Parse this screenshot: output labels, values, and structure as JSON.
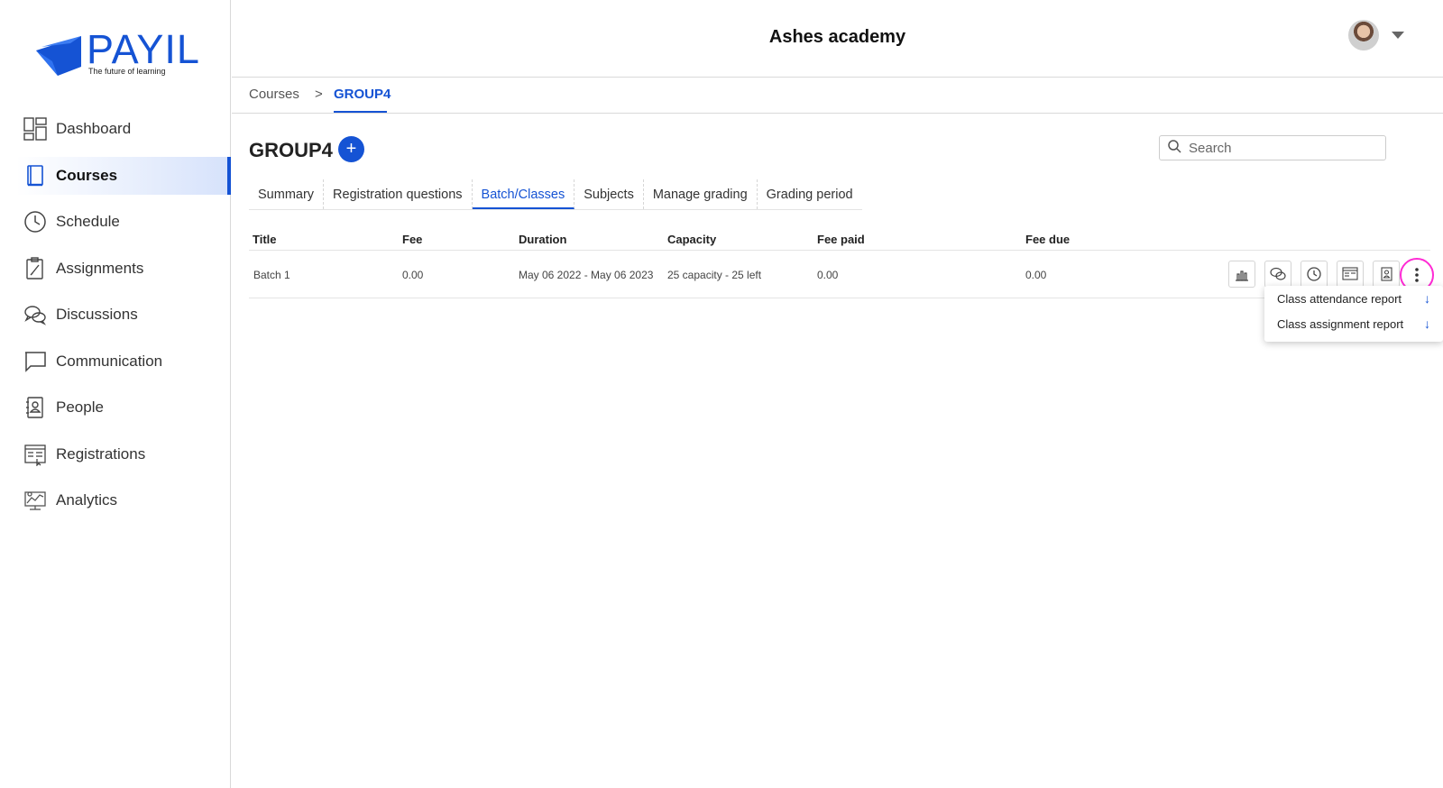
{
  "app": {
    "logo_text": "PAYIL",
    "logo_tagline": "The future of learning",
    "title": "Ashes academy",
    "brand_color": "#1553d4"
  },
  "sidebar": {
    "items": [
      {
        "label": "Dashboard",
        "icon": "dashboard-icon"
      },
      {
        "label": "Courses",
        "icon": "book-icon",
        "active": true
      },
      {
        "label": "Schedule",
        "icon": "clock-icon"
      },
      {
        "label": "Assignments",
        "icon": "assignment-icon"
      },
      {
        "label": "Discussions",
        "icon": "chat-bubbles-icon"
      },
      {
        "label": "Communication",
        "icon": "message-icon"
      },
      {
        "label": "People",
        "icon": "contact-book-icon"
      },
      {
        "label": "Registrations",
        "icon": "registration-icon"
      },
      {
        "label": "Analytics",
        "icon": "analytics-icon"
      }
    ]
  },
  "breadcrumb": {
    "root": "Courses",
    "separator": ">",
    "current": "GROUP4"
  },
  "page": {
    "title": "GROUP4",
    "add_label": "+"
  },
  "search": {
    "placeholder": "Search"
  },
  "tabs": [
    {
      "label": "Summary"
    },
    {
      "label": "Registration questions"
    },
    {
      "label": "Batch/Classes",
      "active": true
    },
    {
      "label": "Subjects"
    },
    {
      "label": "Manage grading"
    },
    {
      "label": "Grading period"
    }
  ],
  "table": {
    "headers": [
      "Title",
      "Fee",
      "Duration",
      "Capacity",
      "Fee paid",
      "Fee due"
    ],
    "rows": [
      {
        "title": "Batch 1",
        "fee": "0.00",
        "duration": "May 06 2022 - May 06 2023",
        "capacity": "25 capacity - 25 left",
        "fee_paid": "0.00",
        "fee_due": "0.00"
      }
    ],
    "row_actions": [
      "bar-chart-icon",
      "chat-bubbles-icon",
      "clock-icon",
      "registration-icon",
      "contact-book-icon",
      "more-vertical-icon"
    ]
  },
  "dropdown": {
    "items": [
      {
        "label": "Class attendance report",
        "icon": "download-arrow-icon",
        "glyph": "↓"
      },
      {
        "label": "Class assignment report",
        "icon": "download-arrow-icon",
        "glyph": "↓"
      }
    ]
  }
}
